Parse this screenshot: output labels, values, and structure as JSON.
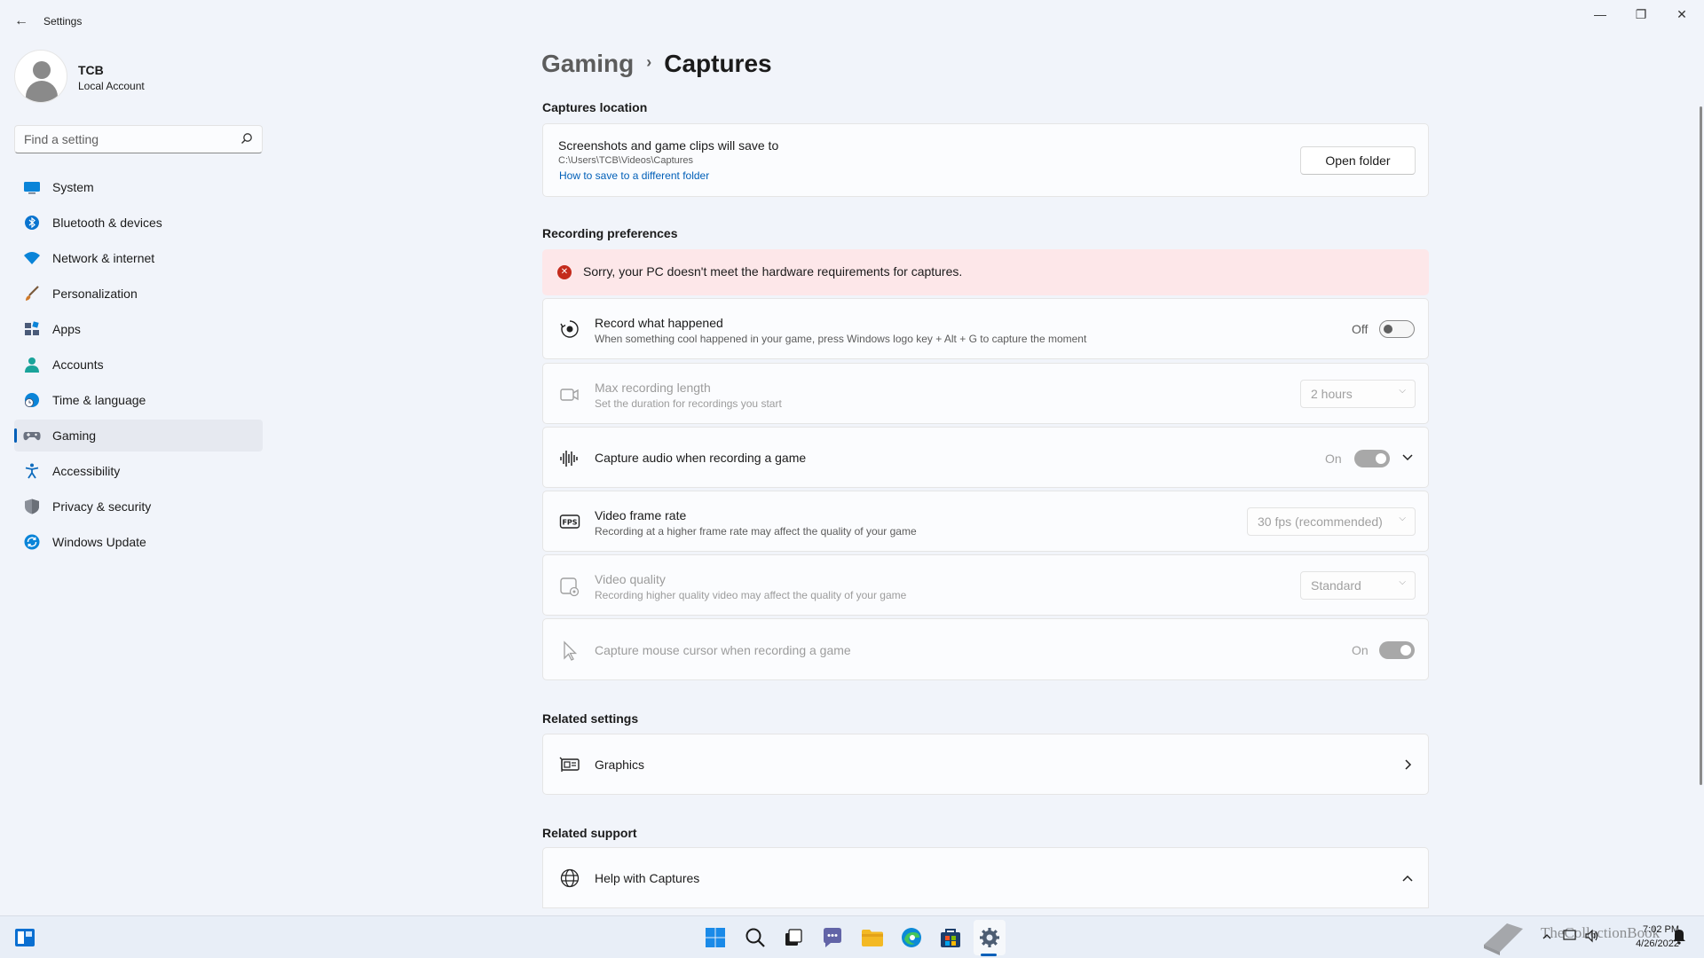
{
  "window": {
    "title": "Settings",
    "controls": {
      "minimize": "—",
      "maximize": "❐",
      "close": "✕"
    },
    "back_glyph": "←"
  },
  "profile": {
    "name": "TCB",
    "account_type": "Local Account"
  },
  "search": {
    "placeholder": "Find a setting"
  },
  "sidebar": {
    "items": [
      {
        "label": "System",
        "icon": "system-icon",
        "color": "#0078d4"
      },
      {
        "label": "Bluetooth & devices",
        "icon": "bluetooth-icon",
        "color": "#0078d4"
      },
      {
        "label": "Network & internet",
        "icon": "wifi-icon",
        "color": "#0078d4"
      },
      {
        "label": "Personalization",
        "icon": "brush-icon",
        "color": "#c97b2d"
      },
      {
        "label": "Apps",
        "icon": "apps-icon",
        "color": "#4a5a78"
      },
      {
        "label": "Accounts",
        "icon": "person-icon",
        "color": "#1aa39a"
      },
      {
        "label": "Time & language",
        "icon": "globe-clock-icon",
        "color": "#0078d4"
      },
      {
        "label": "Gaming",
        "icon": "controller-icon",
        "color": "#6b7280",
        "active": true
      },
      {
        "label": "Accessibility",
        "icon": "accessibility-icon",
        "color": "#0f6cbd"
      },
      {
        "label": "Privacy & security",
        "icon": "shield-icon",
        "color": "#8a8f98"
      },
      {
        "label": "Windows Update",
        "icon": "update-icon",
        "color": "#0078d4"
      }
    ]
  },
  "breadcrumb": {
    "parent": "Gaming",
    "separator": "›",
    "current": "Captures"
  },
  "captures_location": {
    "heading": "Captures location",
    "title": "Screenshots and game clips will save to",
    "path": "C:\\Users\\TCB\\Videos\\Captures",
    "link": "How to save to a different folder",
    "button": "Open folder"
  },
  "recording": {
    "heading": "Recording preferences",
    "error": "Sorry, your PC doesn't meet the hardware requirements for captures.",
    "record_what_happened": {
      "title": "Record what happened",
      "desc": "When something cool happened in your game, press Windows logo key + Alt + G to capture the moment",
      "state": "Off"
    },
    "max_length": {
      "title": "Max recording length",
      "desc": "Set the duration for recordings you start",
      "value": "2 hours"
    },
    "capture_audio": {
      "title": "Capture audio when recording a game",
      "state": "On"
    },
    "frame_rate": {
      "title": "Video frame rate",
      "desc": "Recording at a higher frame rate may affect the quality of your game",
      "value": "30 fps (recommended)"
    },
    "video_quality": {
      "title": "Video quality",
      "desc": "Recording higher quality video may affect the quality of your game",
      "value": "Standard"
    },
    "mouse_cursor": {
      "title": "Capture mouse cursor when recording a game",
      "state": "On"
    }
  },
  "related_settings": {
    "heading": "Related settings",
    "graphics": "Graphics"
  },
  "related_support": {
    "heading": "Related support",
    "help": "Help with Captures"
  },
  "taskbar": {
    "time": "7:02 PM",
    "date": "4/26/2022",
    "watermark": "TheCollectionBook"
  }
}
